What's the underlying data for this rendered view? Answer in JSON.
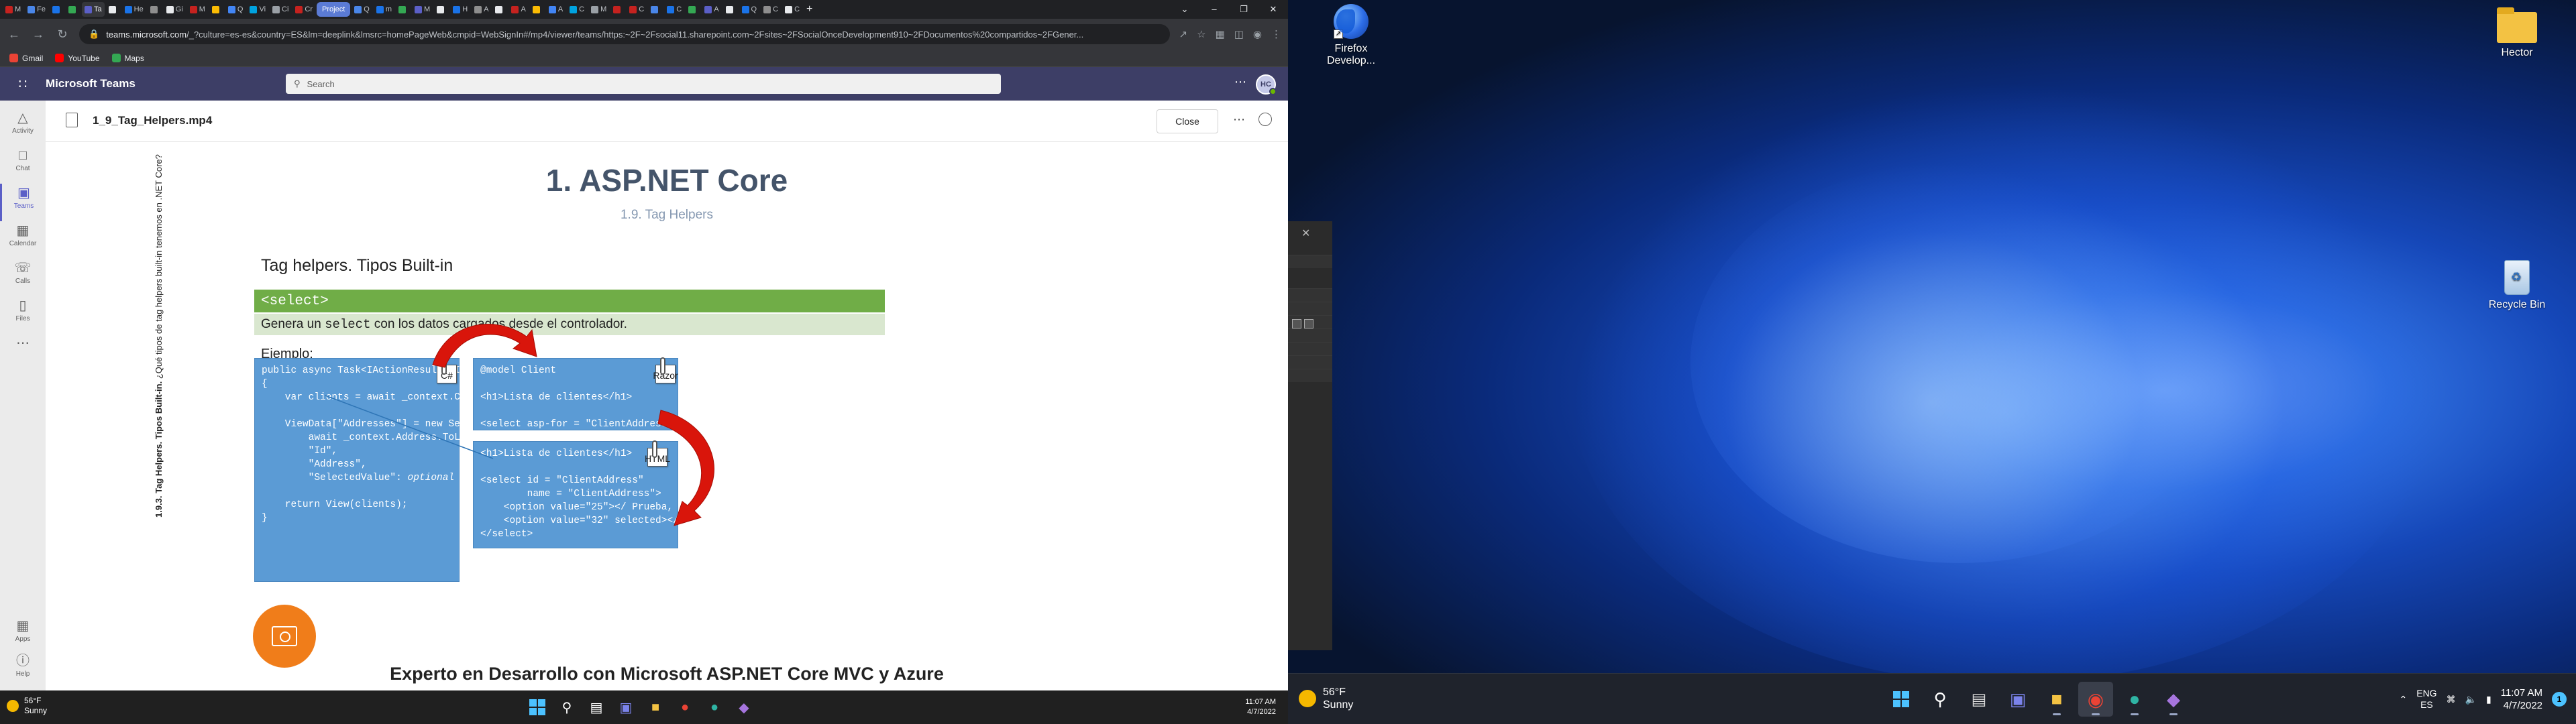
{
  "browser": {
    "tabs": [
      {
        "label": "M"
      },
      {
        "label": "Fe"
      },
      {
        "label": ""
      },
      {
        "label": ""
      },
      {
        "label": "Ta"
      },
      {
        "label": ""
      },
      {
        "label": "He"
      },
      {
        "label": ""
      },
      {
        "label": "Gi"
      },
      {
        "label": "M"
      },
      {
        "label": ""
      },
      {
        "label": "Q"
      },
      {
        "label": "Vi"
      },
      {
        "label": "Ci"
      },
      {
        "label": "Cr"
      },
      {
        "label": "Project",
        "group": true
      },
      {
        "label": "Q"
      },
      {
        "label": "m"
      },
      {
        "label": ""
      },
      {
        "label": "M"
      },
      {
        "label": ""
      },
      {
        "label": "H"
      },
      {
        "label": "A"
      },
      {
        "label": ""
      },
      {
        "label": "A"
      },
      {
        "label": ""
      },
      {
        "label": "A"
      },
      {
        "label": "C"
      },
      {
        "label": "M"
      },
      {
        "label": ""
      },
      {
        "label": "C"
      },
      {
        "label": ""
      },
      {
        "label": "C"
      },
      {
        "label": ""
      },
      {
        "label": "A"
      },
      {
        "label": ""
      },
      {
        "label": "Q"
      },
      {
        "label": "C"
      },
      {
        "label": "C"
      }
    ],
    "new_tab": "+",
    "url_host": "teams.microsoft.com",
    "url_rest": "/_?culture=es-es&country=ES&lm=deeplink&lmsrc=homePageWeb&cmpid=WebSignIn#/mp4/viewer/teams/https:~2F~2Fsocial11.sharepoint.com~2Fsites~2FSocialOnceDevelopment910~2FDocumentos%20compartidos~2FGener...",
    "bookmarks": [
      {
        "label": "Gmail",
        "color": "#ea4335"
      },
      {
        "label": "YouTube",
        "color": "#ff0000"
      },
      {
        "label": "Maps",
        "color": "#34a853"
      }
    ]
  },
  "teams": {
    "app_title": "Microsoft Teams",
    "search_placeholder": "Search",
    "avatar_initials": "HC",
    "rail": [
      {
        "label": "Activity",
        "icon": "bell-icon",
        "glyph": "▲"
      },
      {
        "label": "Chat",
        "icon": "chat-icon",
        "glyph": "▬"
      },
      {
        "label": "Teams",
        "icon": "teams-icon",
        "glyph": "▣",
        "active": true
      },
      {
        "label": "Calendar",
        "icon": "calendar-icon",
        "glyph": "▦"
      },
      {
        "label": "Calls",
        "icon": "phone-icon",
        "glyph": "☎"
      },
      {
        "label": "Files",
        "icon": "file-icon",
        "glyph": "▯"
      },
      {
        "label": "",
        "icon": "more-icon",
        "glyph": "…"
      }
    ],
    "rail_bottom": [
      {
        "label": "Apps",
        "icon": "apps-icon",
        "glyph": "▦"
      },
      {
        "label": "Help",
        "icon": "help-icon",
        "glyph": "?"
      }
    ],
    "viewer": {
      "file_name": "1_9_Tag_Helpers.mp4",
      "close_label": "Close"
    }
  },
  "slide": {
    "title": "1. ASP.NET Core",
    "subtitle": "1.9. Tag Helpers",
    "side_bold": "1.9.3. Tag Helpers. Tipos Built-in.",
    "side_rest": " ¿Qué tipos de tag helpers built-in tenemos en .NET Core?",
    "section": "Tag helpers. Tipos Built-in",
    "green_bar": "<select>",
    "desc_before": "Genera un ",
    "desc_code": "select",
    "desc_after": " con los datos cargados desde el controlador.",
    "ejemplo": "Ejemplo:",
    "code_csharp_1": "public async Task<IActionResult> Index()\n{\n    var clients = await _context.Clients.ToListAsync();\n\n    ViewData[\"Addresses\"] = new SelectList(\n        await _context.Address.ToListAsync(),\n        \"Id\",\n        \"Address\",\n        \"SelectedValue\": ",
    "code_csharp_italic": "optional (32)",
    "code_csharp_2": ");\n\n    return View(clients);\n}",
    "code_razor": "@model Client\n\n<h1>Lista de clientes</h1>\n\n<select asp-for = \"ClientAddress\"\n        asp-items = \"@ViewData[\"Addresses\"]\"></select>",
    "code_html": "<h1>Lista de clientes</h1>\n\n<select id = \"ClientAddress\"\n        name = \"ClientAddress\">\n    <option value=\"25\"></ Prueba, 123</option>\n    <option value=\"32\" selected></ Circulo, 456</option>\n</select>",
    "tag_cs": "C#",
    "tag_razor": "Razor",
    "tag_html": "HTML",
    "footer": "Experto en Desarrollo con Microsoft ASP.NET Core MVC y Azure",
    "arrow_color": "#d9150b",
    "connector_color": "#2e75b6"
  },
  "taskbar_left": {
    "temp": "56°F",
    "condition": "Sunny",
    "time": "11:07 AM",
    "date": "4/7/2022"
  },
  "desktop": {
    "icons": [
      {
        "label": "Firefox Develop...",
        "name": "firefox-developer-icon"
      },
      {
        "label": "Hector",
        "name": "user-folder-icon"
      },
      {
        "label": "Recycle Bin",
        "name": "recycle-bin-icon"
      }
    ],
    "taskbar": {
      "temp": "56°F",
      "condition": "Sunny",
      "lang_1": "ENG",
      "lang_2": "ES",
      "time": "11:07 AM",
      "date": "4/7/2022",
      "notifications": "1"
    }
  }
}
